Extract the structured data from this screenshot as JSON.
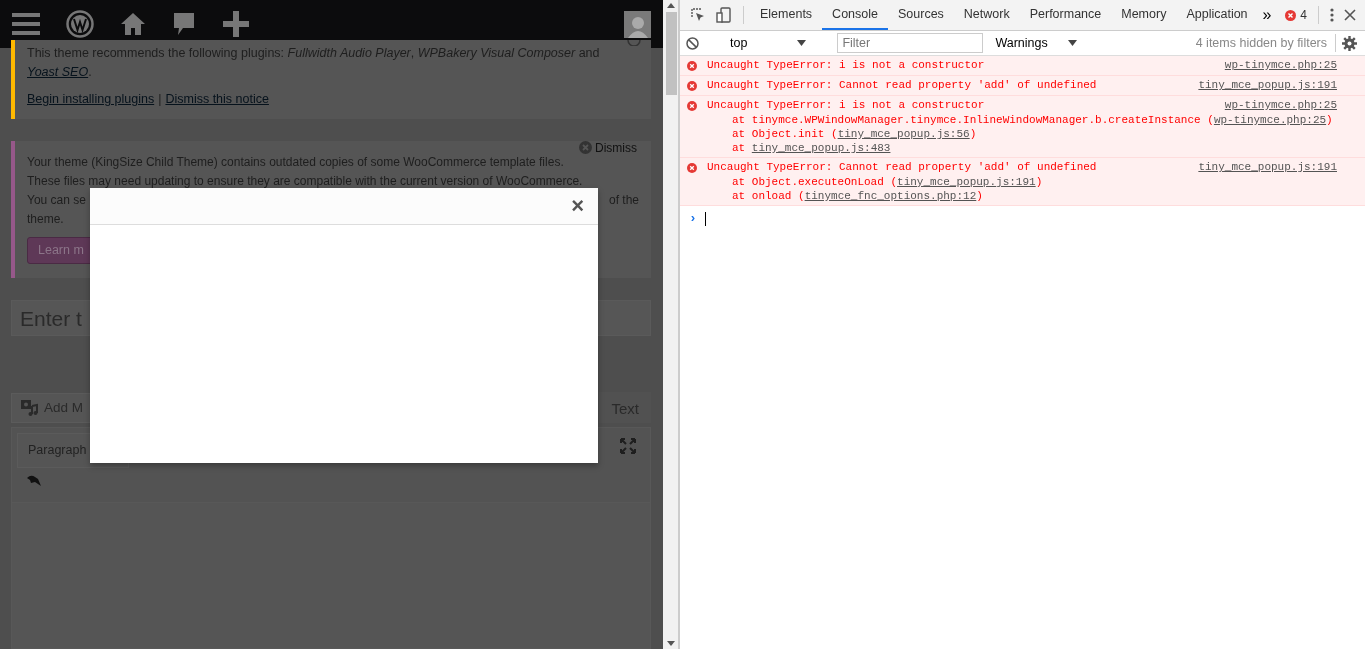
{
  "notices": [
    {
      "kind": "plugins",
      "color": "#ffb900",
      "message": "This theme recommends the following plugins: *Fullwidth Audio Player*, *WPBakery Visual Composer* and ",
      "link": "Yoast SEO",
      "message_end": ".",
      "actions": [
        "Begin installing plugins",
        "|",
        "Dismiss this notice"
      ]
    },
    {
      "kind": "template",
      "color": "#96588a",
      "dismiss": "Dismiss",
      "lines": [
        "Your theme (KingSize Child Theme) contains outdated copies of some WooCommerce template files.",
        "These files may need updating to ensure they are compatible with the current version of WooCommerce."
      ],
      "partial_line": [
        "You can se",
        "of the"
      ],
      "last_line": "theme.",
      "button": "Learn m"
    }
  ],
  "title_field": {
    "placeholder": "Enter t"
  },
  "add_media": "Add M",
  "editor_tab": "Text",
  "format_select": "Paragraph",
  "modal": {
    "close": "×"
  },
  "devtools": {
    "tabs": [
      {
        "label": "Elements",
        "selected": false
      },
      {
        "label": "Console",
        "selected": true
      },
      {
        "label": "Sources",
        "selected": false
      },
      {
        "label": "Network",
        "selected": false
      },
      {
        "label": "Performance",
        "selected": false
      },
      {
        "label": "Memory",
        "selected": false
      },
      {
        "label": "Application",
        "selected": false
      }
    ],
    "overflow": "»",
    "error_count": "4",
    "context": "top",
    "filter": {
      "placeholder": "Filter"
    },
    "levels": "Warnings",
    "hidden_note": "4 items hidden by filters",
    "messages": [
      {
        "text": "Uncaught TypeError: i is not a constructor",
        "source": "wp-tinymce.php:25"
      },
      {
        "text": "Uncaught TypeError: Cannot read property 'add' of undefined",
        "source": "tiny_mce_popup.js:191"
      },
      {
        "text": "Uncaught TypeError: i is not a constructor",
        "source": "wp-tinymce.php:25",
        "stack": [
          {
            "prefix": "at tinymce.WPWindowManager.tinymce.InlineWindowManager.b.createInstance (",
            "link": "wp-tinymce.php:25",
            "suffix": ")"
          },
          {
            "prefix": "at Object.init (",
            "link": "tiny_mce_popup.js:56",
            "suffix": ")"
          },
          {
            "prefix": "at ",
            "link": "tiny_mce_popup.js:483"
          }
        ]
      },
      {
        "text": "Uncaught TypeError: Cannot read property 'add' of undefined",
        "source": "tiny_mce_popup.js:191",
        "stack": [
          {
            "prefix": "at Object.executeOnLoad (",
            "link": "tiny_mce_popup.js:191",
            "suffix": ")"
          },
          {
            "prefix": "at onload (",
            "link": "tinymce_fnc_options.php:12",
            "suffix": ")"
          }
        ]
      }
    ],
    "prompt": "›"
  }
}
